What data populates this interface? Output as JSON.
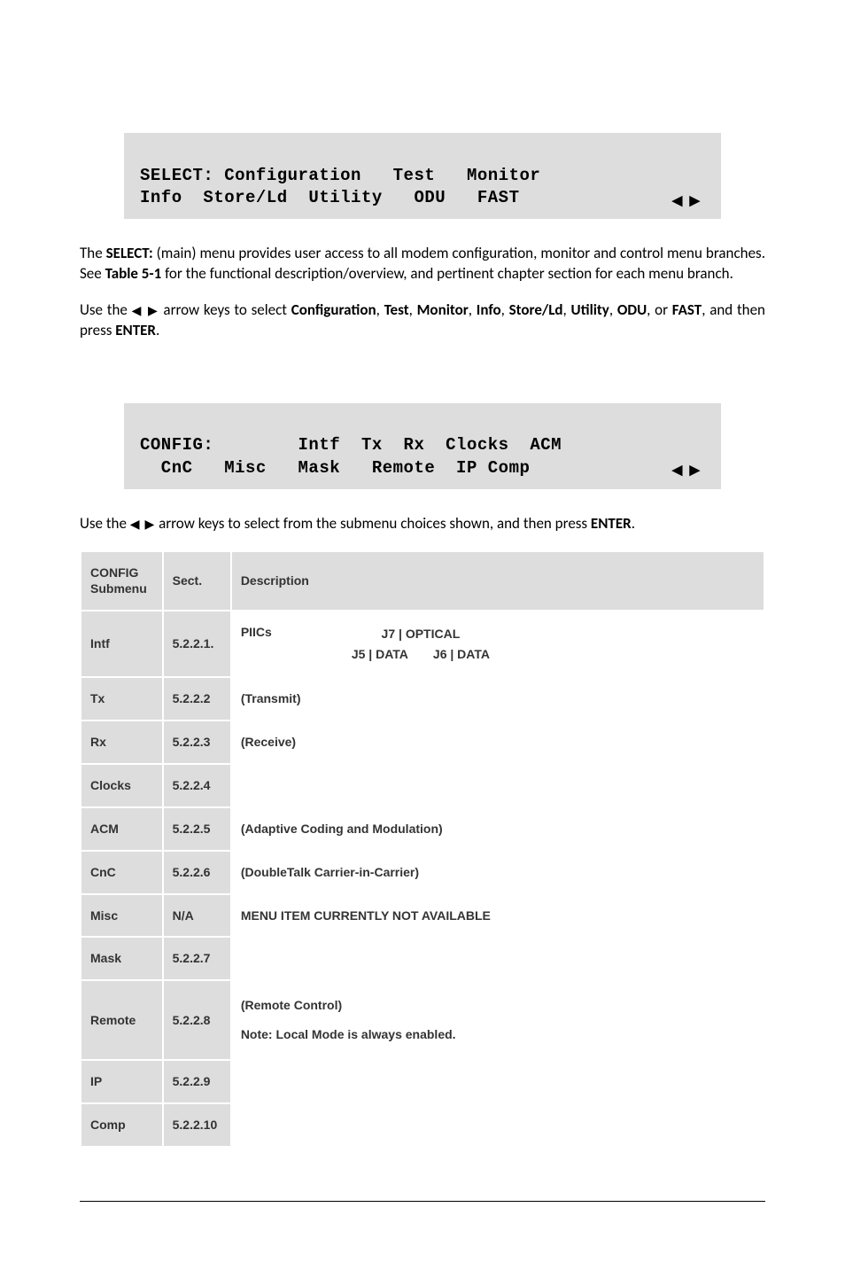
{
  "lcd1": {
    "line1": "SELECT: Configuration   Test   Monitor",
    "line2": "Info  Store/Ld  Utility   ODU   FAST",
    "arrows": "◀ ▶"
  },
  "para1": {
    "pre": "The ",
    "b1": "SELECT:",
    "mid1": " (main) menu provides user access to all modem configuration, monitor and control menu branches. See ",
    "b2": "Table 5-1",
    "mid2": " for the functional description/overview, and pertinent chapter section for each menu branch."
  },
  "para2": {
    "pre": "Use the ",
    "arrows": "◀ ▶",
    "mid": " arrow keys to select ",
    "items": [
      "Configuration",
      "Test",
      "Monitor",
      "Info",
      "Store/Ld",
      "Utility",
      "ODU",
      "FAST"
    ],
    "post1": ", and then press ",
    "enter": "ENTER",
    "post2": "."
  },
  "lcd2": {
    "line1": "CONFIG:        Intf  Tx  Rx  Clocks  ACM",
    "line2": "  CnC   Misc   Mask   Remote  IP Comp",
    "arrows": "◀ ▶"
  },
  "para3": {
    "pre": "Use the ",
    "arrows": "◀ ▶",
    "mid": " arrow keys to select from the submenu choices shown, and then press ",
    "enter": "ENTER",
    "post": "."
  },
  "table": {
    "headers": {
      "c1": "CONFIG Submenu",
      "c2": "Sect.",
      "c3": "Description"
    },
    "rows": [
      {
        "c1": "Intf",
        "c2": "5.2.2.1.",
        "desc_type": "intf",
        "d_left": "PIICs",
        "d_r1": "J7 | OPTICAL",
        "d_r2a": "J5 | DATA",
        "d_r2b": "J6 | DATA"
      },
      {
        "c1": "Tx",
        "c2": "5.2.2.2",
        "desc": "(Transmit)"
      },
      {
        "c1": "Rx",
        "c2": "5.2.2.3",
        "desc": "(Receive)"
      },
      {
        "c1": "Clocks",
        "c2": "5.2.2.4",
        "desc": ""
      },
      {
        "c1": "ACM",
        "c2": "5.2.2.5",
        "desc": "(Adaptive Coding and Modulation)"
      },
      {
        "c1": "CnC",
        "c2": "5.2.2.6",
        "desc": "(DoubleTalk Carrier-in-Carrier)"
      },
      {
        "c1": "Misc",
        "c2": "N/A",
        "desc": "MENU ITEM CURRENTLY NOT AVAILABLE"
      },
      {
        "c1": "Mask",
        "c2": "5.2.2.7",
        "desc": ""
      },
      {
        "c1": "Remote",
        "c2": "5.2.2.8",
        "desc_type": "remote",
        "d1": "(Remote Control)",
        "d2": "Note: Local Mode is always enabled."
      },
      {
        "c1": "IP",
        "c2": "5.2.2.9",
        "desc": ""
      },
      {
        "c1": "Comp",
        "c2": "5.2.2.10",
        "desc": ""
      }
    ]
  }
}
